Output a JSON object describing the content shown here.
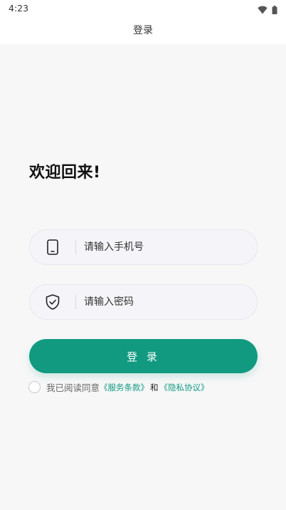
{
  "status_bar": {
    "time": "4:23",
    "wifi_icon": "wifi-icon",
    "battery_icon": "battery-icon"
  },
  "nav": {
    "title": "登录"
  },
  "welcome": {
    "title": "欢迎回来!"
  },
  "phone": {
    "icon": "phone-icon",
    "placeholder": "请输入手机号",
    "value": ""
  },
  "password": {
    "icon": "shield-check-icon",
    "placeholder": "请输入密码",
    "value": ""
  },
  "login_button": {
    "label": "登 录"
  },
  "agreement": {
    "checked": false,
    "prefix": "我已阅读同意",
    "service_terms": "《服务条款》",
    "and": "和",
    "privacy_policy": "《隐私协议》"
  },
  "colors": {
    "accent": "#119a80",
    "background": "#f7f7f8",
    "input_background": "#f5f5f9"
  }
}
